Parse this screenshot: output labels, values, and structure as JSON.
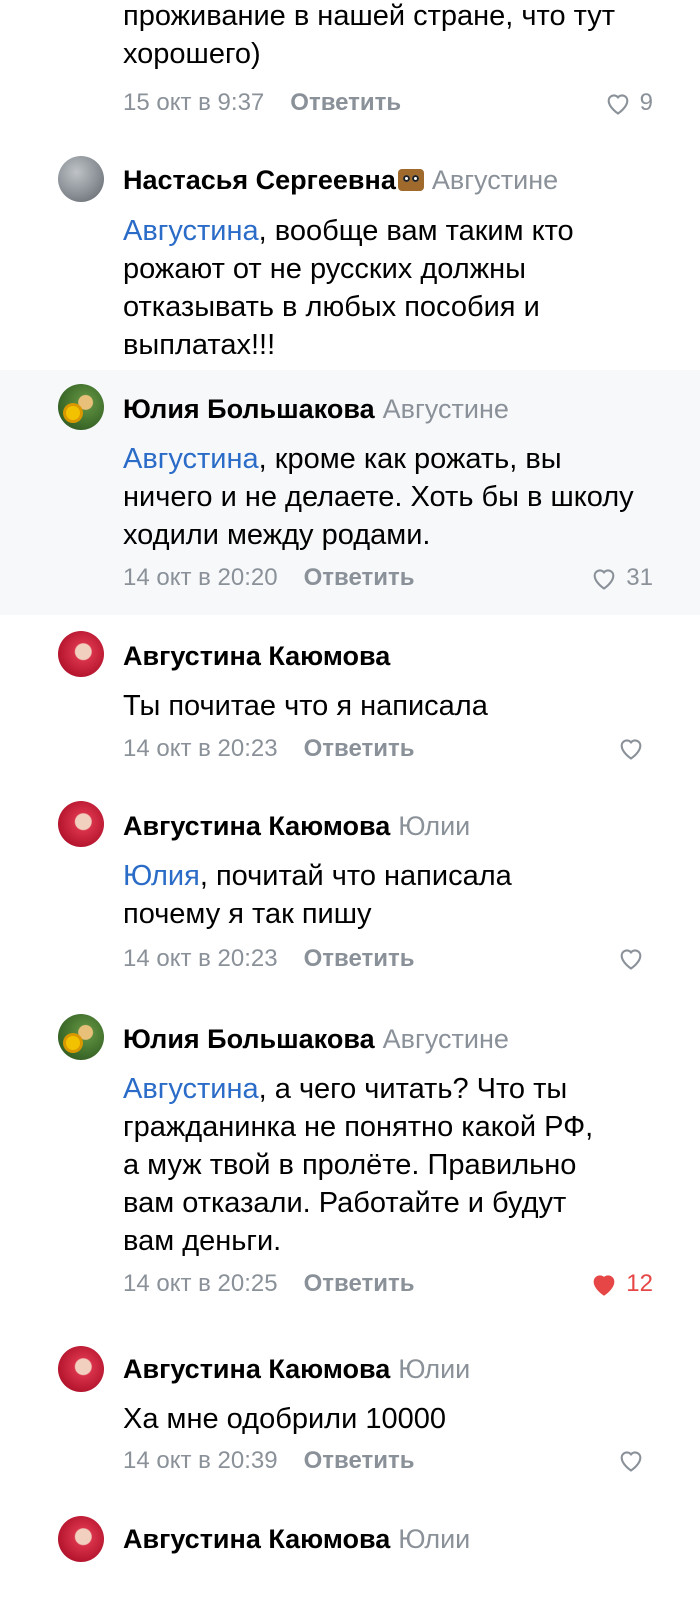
{
  "comments": [
    {
      "text_lines": "проживание в нашей стране, что тут хорошего)",
      "time": "15 окт в 9:37",
      "reply_label": "Ответить",
      "likes": "9",
      "liked": false
    },
    {
      "author": "Настасья Сергеевна",
      "reply_to": "Августине",
      "mention": "Августина",
      "text": ", вообще вам таким кто рожают от не русских должны отказывать в любых пособия и выплатах!!!"
    },
    {
      "author": "Юлия Большакова",
      "reply_to": "Августине",
      "mention": "Августина",
      "text": ", кроме как рожать, вы ничего и не делаете. Хоть бы в школу ходили между родами.",
      "time": "14 окт в 20:20",
      "reply_label": "Ответить",
      "likes": "31",
      "liked": false
    },
    {
      "author": "Августина Каюмова",
      "text": "Ты почитае что я написала",
      "time": "14 окт в 20:23",
      "reply_label": "Ответить",
      "likes": "",
      "liked": false
    },
    {
      "author": "Августина Каюмова",
      "reply_to": "Юлии",
      "mention": "Юлия",
      "text": ", почитай что написала почему я так пишу",
      "time": "14 окт в 20:23",
      "reply_label": "Ответить",
      "likes": "",
      "liked": false
    },
    {
      "author": "Юлия Большакова",
      "reply_to": "Августине",
      "mention": "Августина",
      "text": ", а чего читать? Что ты гражданинка не понятно какой РФ, а муж твой в пролёте. Правильно вам отказали. Работайте и будут вам деньги.",
      "time": "14 окт в 20:25",
      "reply_label": "Ответить",
      "likes": "12",
      "liked": true
    },
    {
      "author": "Августина Каюмова",
      "reply_to": "Юлии",
      "text": "Ха мне одобрили 10000",
      "time": "14 окт в 20:39",
      "reply_label": "Ответить",
      "likes": "",
      "liked": false
    },
    {
      "author": "Августина Каюмова",
      "reply_to": "Юлии"
    }
  ],
  "colors": {
    "mention": "#2a6cc7",
    "meta": "#8a9199",
    "liked": "#e64646"
  }
}
